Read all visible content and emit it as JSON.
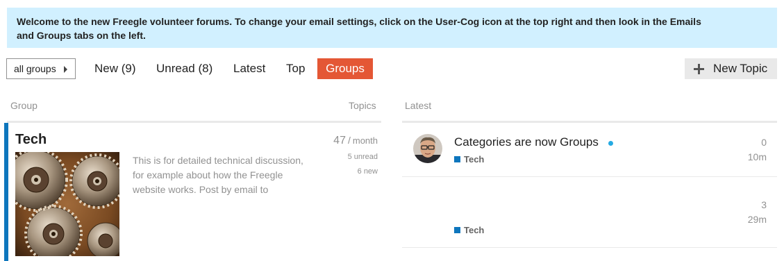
{
  "banner": {
    "line1": "Welcome to the new Freegle volunteer forums. To change your email settings, click on the User-Cog icon at the top right and then look in the Emails",
    "line2": "and Groups tabs on the left."
  },
  "nav": {
    "category_dropdown": "all groups",
    "items": [
      {
        "label": "New (9)"
      },
      {
        "label": "Unread (8)"
      },
      {
        "label": "Latest"
      },
      {
        "label": "Top"
      },
      {
        "label": "Groups",
        "active": true
      }
    ],
    "new_topic_label": "New Topic"
  },
  "columns": {
    "group": "Group",
    "topics": "Topics",
    "latest": "Latest"
  },
  "group": {
    "name": "Tech",
    "description_lines": [
      "This is for detailed technical discussion,",
      "for example about how the Freegle",
      "website works. Post by email to"
    ],
    "topics_per_month": "47",
    "slash": "/",
    "period": "month",
    "unread": "5 unread",
    "new": "6 new",
    "image_icon": "gears-image",
    "accent_color": "#0e76bd"
  },
  "latest": [
    {
      "title": "Categories are now Groups",
      "category": "Tech",
      "replies": "0",
      "age": "10m",
      "unread_dot": true,
      "avatar_icon": "user-avatar"
    },
    {
      "title": "",
      "category": "Tech",
      "replies": "3",
      "age": "29m",
      "avatar_icon": "user-avatar-partial"
    }
  ],
  "colors": {
    "banner_bg": "#d1f0ff",
    "active_tab": "#e45735",
    "category": "#0e76bd",
    "unread_dot": "#25aae2"
  }
}
